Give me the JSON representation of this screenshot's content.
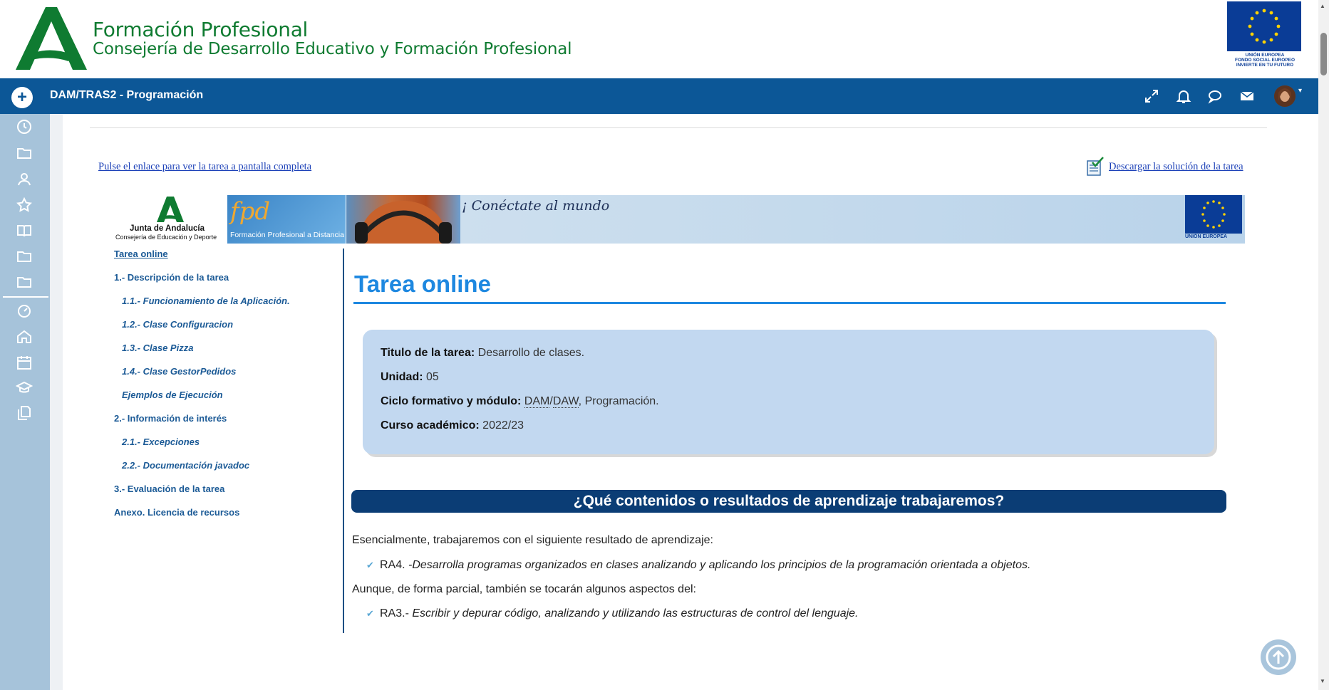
{
  "header": {
    "brand_title": "Formación Profesional",
    "brand_subtitle": "Consejería de Desarrollo Educativo y Formación Profesional",
    "eu_caption": [
      "UNIÓN EUROPEA",
      "FONDO SOCIAL EUROPEO",
      "INVIERTE EN TU FUTURO"
    ]
  },
  "navbar": {
    "add_label": "+",
    "course_title": "DAM/TRAS2 - Programación",
    "icons": [
      "fullscreen-icon",
      "bell-icon",
      "chat-icon",
      "envelope-icon"
    ],
    "caret": "▾"
  },
  "rail": {
    "icons": [
      "clock-icon",
      "folder-icon",
      "users-icon",
      "star-icon",
      "book-icon",
      "folder-icon",
      "folder-icon",
      "dashboard-icon",
      "home-icon",
      "calendar-icon",
      "graduation-icon",
      "files-icon"
    ]
  },
  "content": {
    "full_screen_link": "Pulse el enlace para ver la tarea a pantalla completa",
    "download_link": "Descargar la solución de la tarea",
    "banner": {
      "ja_name": "Junta de Andalucía",
      "ja_sub": "Consejería de Educación y Deporte",
      "fpd_text": "Formación Profesional a Distancia",
      "slogan": "¡ Conéctate al mundo",
      "eu_label": "UNIÓN EUROPEA"
    },
    "toc": [
      {
        "label": "Tarea online",
        "level": 0,
        "current": true
      },
      {
        "label": "1.- Descripción de la tarea",
        "level": 0
      },
      {
        "label": "1.1.- Funcionamiento de la Aplicación.",
        "level": 1
      },
      {
        "label": "1.2.- Clase Configuracion",
        "level": 1
      },
      {
        "label": "1.3.- Clase Pizza",
        "level": 1
      },
      {
        "label": "1.4.- Clase GestorPedidos",
        "level": 1
      },
      {
        "label": "Ejemplos de Ejecución",
        "level": 1
      },
      {
        "label": "2.- Información de interés",
        "level": 0
      },
      {
        "label": "2.1.- Excepciones",
        "level": 1
      },
      {
        "label": "2.2.- Documentación javadoc",
        "level": 1
      },
      {
        "label": "3.- Evaluación de la tarea",
        "level": 0
      },
      {
        "label": "Anexo. Licencia de recursos",
        "level": 0
      }
    ],
    "article_title": "Tarea online",
    "info": {
      "titulo_label": "Titulo de la tarea:",
      "titulo_value": " Desarrollo de clases.",
      "unidad_label": "Unidad:",
      "unidad_value": " 05",
      "ciclo_label": "Ciclo formativo y módulo:",
      "ciclo_abbr1": "DAM",
      "ciclo_sep": "/",
      "ciclo_abbr2": "DAW",
      "ciclo_rest": ", Programación.",
      "curso_label": "Curso académico:",
      "curso_value": " 2022/23"
    },
    "section_heading": "¿Qué contenidos o resultados de aprendizaje trabajaremos?",
    "intro": "Esencialmente, trabajaremos con el siguiente resultado de aprendizaje:",
    "ra4_code": "RA4.",
    "ra4_text": " -Desarrolla programas organizados en clases analizando y aplicando los principios de la programación orientada a objetos.",
    "partial": "Aunque, de forma parcial, también se tocarán algunos aspectos del:",
    "ra3_code": "RA3.-",
    "ra3_text": " Escribir y depurar código, analizando y utilizando las estructuras de control del lenguaje.",
    "check_glyph": "✔"
  },
  "colors": {
    "brand_green": "#0f7b31",
    "navbar_blue": "#0c5797",
    "rail_blue": "#a6c3da",
    "title_blue": "#1e88e0",
    "section_navy": "#0b3d75",
    "info_bg": "#c2d8f0"
  }
}
